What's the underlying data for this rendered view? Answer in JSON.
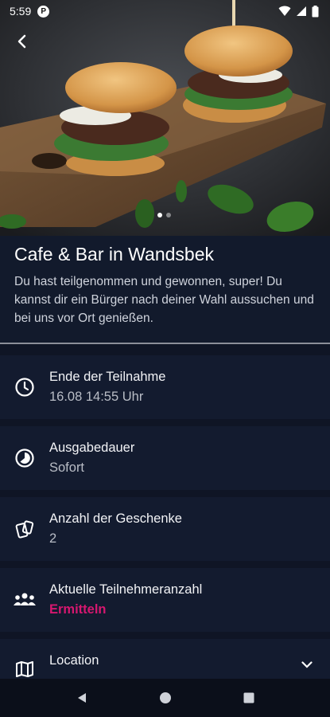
{
  "status_bar": {
    "time": "5:59",
    "app_badge": "P"
  },
  "hero": {
    "image_subject": "burger-on-wooden-board-photo",
    "dots_count": 2,
    "active_dot": 0
  },
  "event": {
    "title": "Cafe & Bar in Wandsbek",
    "description": "Du hast teilgenommen und gewonnen, super! Du kannst dir ein Bürger nach deiner Wahl aussuchen und bei uns vor Ort genießen."
  },
  "info": [
    {
      "icon": "clock-icon",
      "label": "Ende der Teilnahme",
      "value": "16.08 14:55 Uhr"
    },
    {
      "icon": "timelapse-icon",
      "label": "Ausgabedauer",
      "value": "Sofort"
    },
    {
      "icon": "gift-cards-icon",
      "label": "Anzahl der Geschenke",
      "value": "2"
    },
    {
      "icon": "people-group-icon",
      "label": "Aktuelle Teilnehmeranzahl",
      "value": "Ermitteln"
    },
    {
      "icon": "map-icon",
      "label": "Location"
    }
  ],
  "colors": {
    "background": "#0f1525",
    "card": "#131b2f",
    "accent": "#d6176f"
  }
}
